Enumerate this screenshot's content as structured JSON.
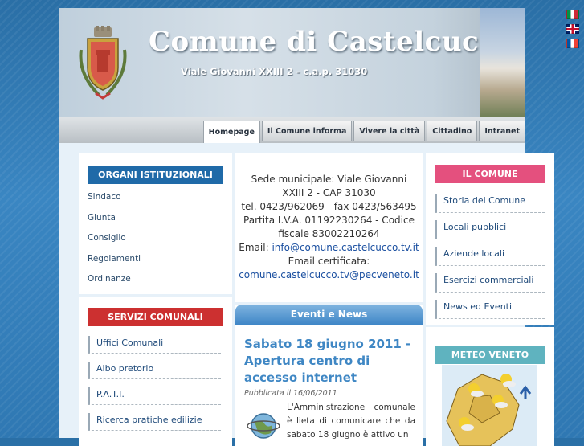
{
  "header": {
    "title": "Comune di Castelcucco",
    "address": "Viale Giovanni XXIII 2 - c.a.p. 31030"
  },
  "languages": [
    "italiano",
    "english",
    "français"
  ],
  "nav": {
    "tabs": [
      "Homepage",
      "Il Comune informa",
      "Vivere la città",
      "Cittadino",
      "Intranet"
    ],
    "active": "Homepage"
  },
  "left": {
    "organi": {
      "title": "ORGANI ISTITUZIONALI",
      "items": [
        "Sindaco",
        "Giunta",
        "Consiglio",
        "Regolamenti",
        "Ordinanze"
      ]
    },
    "servizi": {
      "title": "SERVIZI COMUNALI",
      "items": [
        "Uffici Comunali",
        "Albo pretorio",
        "P.A.T.I.",
        "Ricerca pratiche edilizie"
      ]
    }
  },
  "contact": {
    "lines": [
      "Sede municipale: Viale Giovanni",
      "XXIII 2 - CAP 31030",
      "tel. 0423/962069 - fax 0423/563495",
      "Partita I.V.A. 01192230264 - Codice",
      "fiscale 83002210264"
    ],
    "email_label": "Email: ",
    "email": "info@comune.castelcucco.tv.it",
    "pec_label": "Email certificata:",
    "pec": "comune.castelcucco.tv@pecveneto.it"
  },
  "events": {
    "title": "Eventi e News",
    "news_title": "Sabato 18 giugno 2011 - Apertura centro di accesso internet",
    "date": "Pubblicata il 16/06/2011",
    "body": "L'Amministrazione comunale è lieta di comunicare che da sabato 18 giugno è attivo un"
  },
  "right": {
    "comune": {
      "title": "IL COMUNE",
      "items": [
        "Storia del Comune",
        "Locali pubblici",
        "Aziende locali",
        "Esercizi commerciali",
        "News ed Eventi"
      ]
    },
    "meteo": {
      "title": "METEO VENETO"
    }
  },
  "colors": {
    "blue_heading": "#1f6aa8",
    "red_heading": "#cc3030",
    "pink_heading": "#e4507e",
    "teal_heading": "#5fb3bf"
  }
}
